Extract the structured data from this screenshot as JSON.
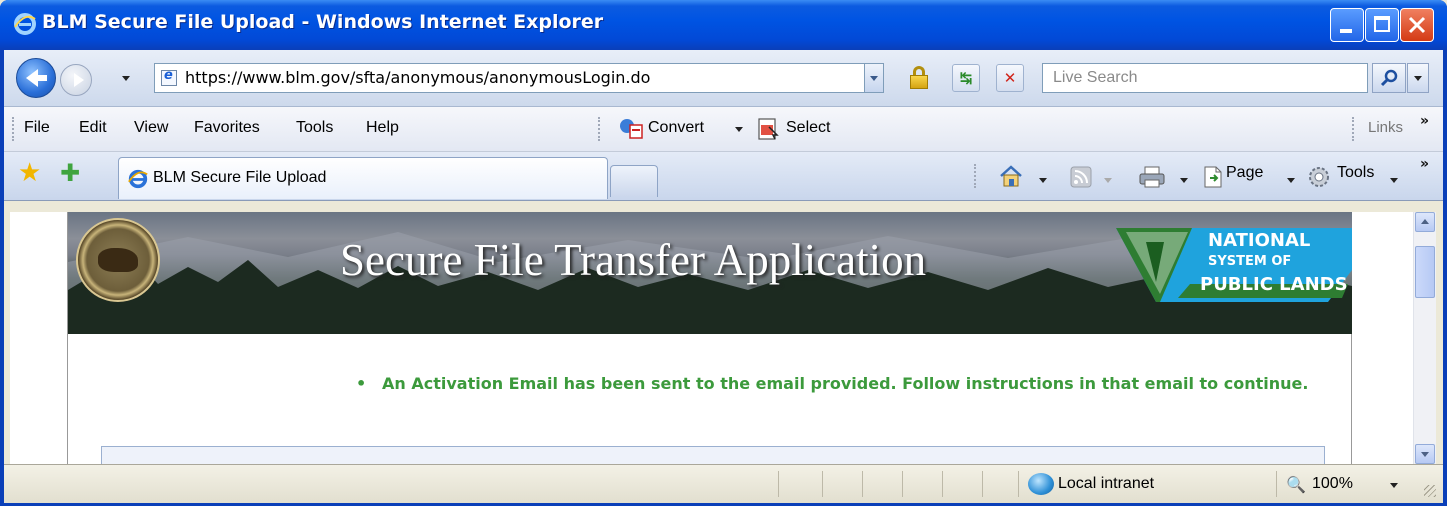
{
  "window": {
    "title": "BLM Secure File Upload - Windows Internet Explorer"
  },
  "navigation": {
    "url": "https://www.blm.gov/sfta/anonymous/anonymousLogin.do",
    "search_placeholder": "Live Search"
  },
  "menu": {
    "items": [
      "File",
      "Edit",
      "View",
      "Favorites",
      "Tools",
      "Help"
    ],
    "convert_label": "Convert",
    "select_label": "Select",
    "links_label": "Links"
  },
  "tabs": {
    "active_tab": "BLM Secure File Upload"
  },
  "command_bar": {
    "page_label": "Page",
    "tools_label": "Tools"
  },
  "page": {
    "banner_title": "Secure File Transfer Application",
    "logo_lines": [
      "NATIONAL",
      "SYSTEM OF",
      "PUBLIC LANDS"
    ],
    "message": "An Activation Email has been sent to the email provided. Follow instructions in that email to continue."
  },
  "status_bar": {
    "zone": "Local intranet",
    "zoom": "100%"
  },
  "colors": {
    "titlebar": "#0054e3",
    "message_green": "#3c9a3c",
    "logo_blue": "#1fa3dd",
    "logo_green": "#2e7d32"
  }
}
